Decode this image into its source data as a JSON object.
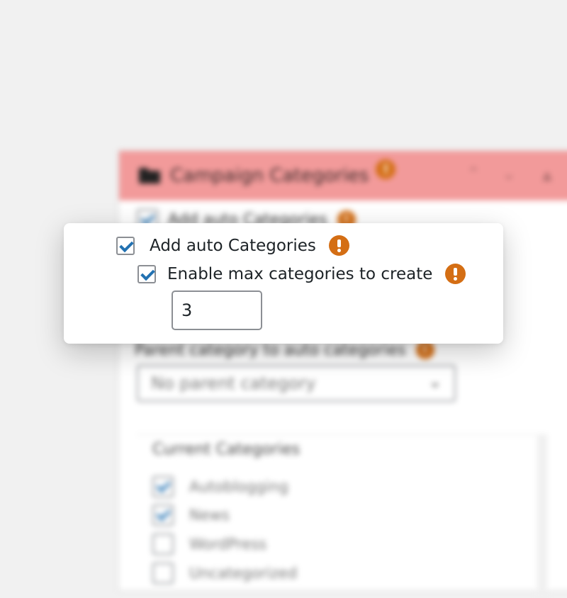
{
  "panel": {
    "title": "Campaign Categories",
    "header_color": "#f29a9a",
    "bg_options": [
      {
        "label": "Add auto Categories",
        "checked": true
      }
    ],
    "parent_label": "Parent category to auto categories",
    "parent_select_value": "No parent category",
    "current_categories_heading": "Current Categories",
    "categories": [
      {
        "label": "Autoblogging",
        "checked": true
      },
      {
        "label": "News",
        "checked": true
      },
      {
        "label": "WordPress",
        "checked": false
      },
      {
        "label": "Uncategorized",
        "checked": false
      }
    ]
  },
  "popup": {
    "add_auto_categories": {
      "label": "Add auto Categories",
      "checked": true
    },
    "enable_max_categories": {
      "label": "Enable max categories to create",
      "checked": true
    },
    "max_categories_value": "3"
  },
  "colors": {
    "warning": "#d46e14",
    "checkmark": "#2271b1"
  },
  "icons": {
    "header": "folder-icon",
    "help": "exclamation-icon"
  }
}
